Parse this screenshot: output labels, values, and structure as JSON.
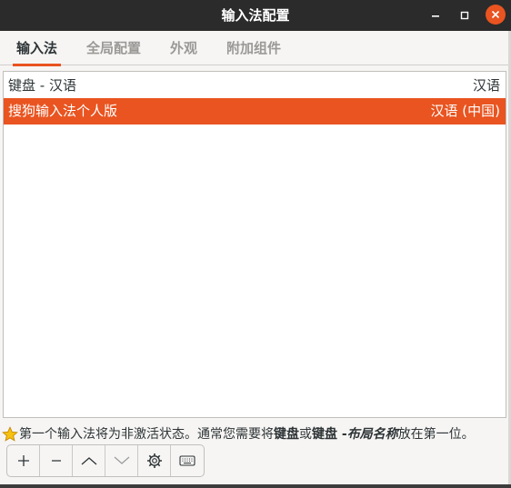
{
  "window": {
    "title": "输入法配置"
  },
  "tabs": [
    {
      "label": "输入法",
      "active": true
    },
    {
      "label": "全局配置",
      "active": false
    },
    {
      "label": "外观",
      "active": false
    },
    {
      "label": "附加组件",
      "active": false
    }
  ],
  "list": {
    "header": {
      "name": "键盘 - 汉语",
      "language": "汉语"
    },
    "items": [
      {
        "name": "搜狗输入法个人版",
        "language": "汉语 (中国)",
        "selected": true
      }
    ]
  },
  "hint": {
    "part1": "第一个输入法将为非激活状态。通常您需要将",
    "bold1": "键盘",
    "part2": "或",
    "bold2": "键盘 - ",
    "bold_italic": "布局名称",
    "part3": "放在第一位。"
  },
  "toolbar": {
    "buttons": [
      "add-icon",
      "remove-icon",
      "move-up-icon",
      "move-down-icon",
      "configure-icon",
      "keyboard-layout-icon"
    ]
  },
  "colors": {
    "accent": "#e95420",
    "titlebar": "#2b2b2b",
    "background": "#f6f5f4"
  }
}
